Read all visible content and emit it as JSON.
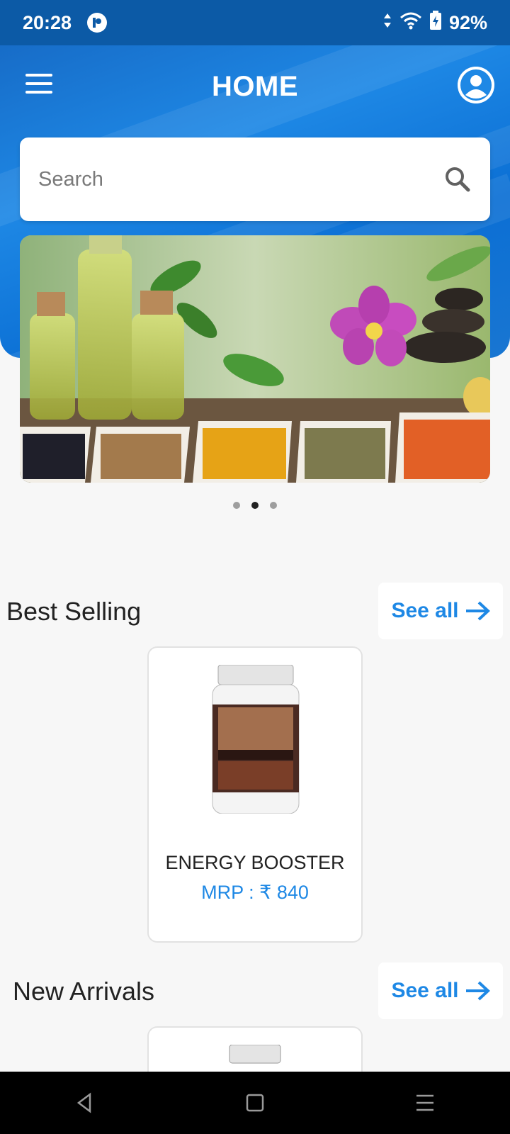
{
  "status_bar": {
    "time": "20:28",
    "battery": "92%"
  },
  "app_bar": {
    "title": "HOME"
  },
  "search": {
    "placeholder": "Search"
  },
  "carousel": {
    "active_index": 1,
    "count": 3
  },
  "sections": {
    "best_selling": {
      "title": "Best Selling",
      "see_all": "See all"
    },
    "new_arrivals": {
      "title": "New Arrivals",
      "see_all": "See all"
    }
  },
  "products": {
    "best_selling": [
      {
        "name": "ENERGY BOOSTER",
        "price": "MRP : ₹ 840"
      }
    ]
  },
  "colors": {
    "accent": "#1e88e5",
    "header": "#1565c0"
  }
}
